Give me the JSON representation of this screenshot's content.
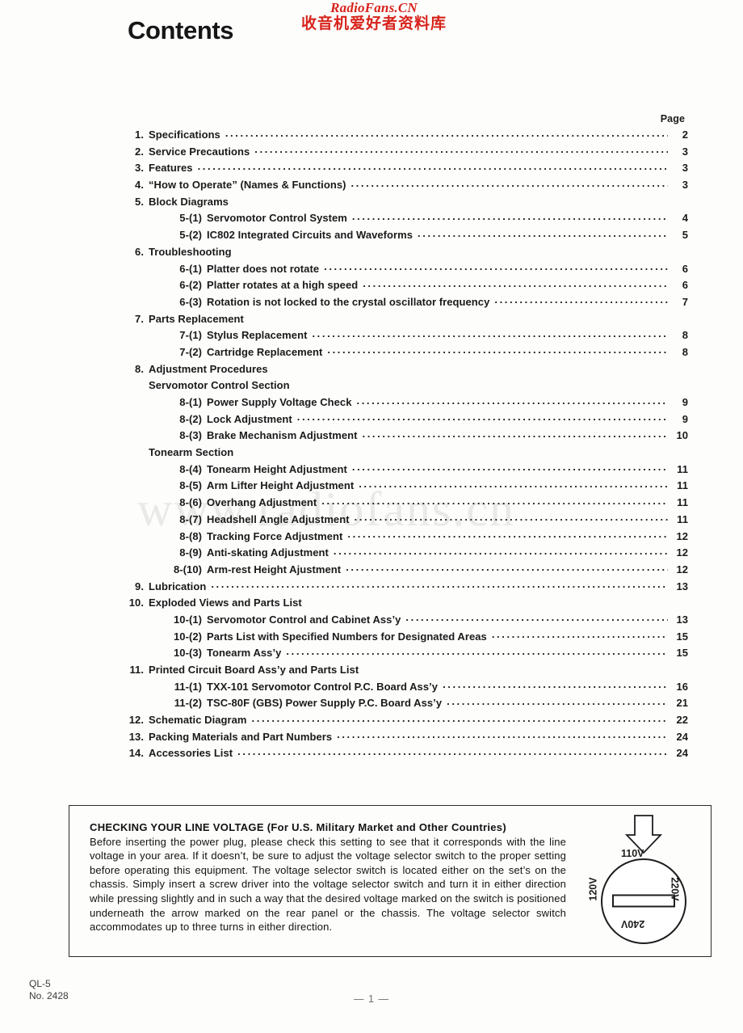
{
  "logo": {
    "english": "RadioFans.CN",
    "chinese": "收音机爱好者资料库",
    "color": "#d7231b"
  },
  "page_title": "Contents",
  "watermark": "www.radiofans.cn",
  "toc": {
    "page_column_header": "Page",
    "rows": [
      {
        "level": 1,
        "num": "1.",
        "label": "Specifications",
        "page": "2"
      },
      {
        "level": 1,
        "num": "2.",
        "label": "Service Precautions",
        "page": "3"
      },
      {
        "level": 1,
        "num": "3.",
        "label": "Features",
        "page": "3"
      },
      {
        "level": 1,
        "num": "4.",
        "label": "“How to Operate” (Names & Functions)",
        "page": "3"
      },
      {
        "level": 1,
        "num": "5.",
        "label": "Block Diagrams",
        "page": ""
      },
      {
        "level": 2,
        "num": "5-(1)",
        "label": "Servomotor Control System",
        "page": "4"
      },
      {
        "level": 2,
        "num": "5-(2)",
        "label": "IC802 Integrated Circuits and Waveforms",
        "page": "5"
      },
      {
        "level": 1,
        "num": "6.",
        "label": "Troubleshooting",
        "page": ""
      },
      {
        "level": 2,
        "num": "6-(1)",
        "label": "Platter does not rotate",
        "page": "6"
      },
      {
        "level": 2,
        "num": "6-(2)",
        "label": "Platter rotates at a high speed",
        "page": "6"
      },
      {
        "level": 2,
        "num": "6-(3)",
        "label": "Rotation is not locked to the crystal oscillator frequency",
        "page": "7"
      },
      {
        "level": 1,
        "num": "7.",
        "label": "Parts Replacement",
        "page": ""
      },
      {
        "level": 2,
        "num": "7-(1)",
        "label": "Stylus Replacement",
        "page": "8"
      },
      {
        "level": 2,
        "num": "7-(2)",
        "label": "Cartridge Replacement",
        "page": "8"
      },
      {
        "level": 1,
        "num": "8.",
        "label": "Adjustment Procedures",
        "page": ""
      },
      {
        "level": 0,
        "num": "",
        "label": "Servomotor Control Section",
        "page": ""
      },
      {
        "level": 2,
        "num": "8-(1)",
        "label": "Power Supply Voltage Check",
        "page": "9"
      },
      {
        "level": 2,
        "num": "8-(2)",
        "label": "Lock Adjustment",
        "page": "9"
      },
      {
        "level": 2,
        "num": "8-(3)",
        "label": "Brake Mechanism Adjustment",
        "page": "10"
      },
      {
        "level": 0,
        "num": "",
        "label": "Tonearm Section",
        "page": ""
      },
      {
        "level": 2,
        "num": "8-(4)",
        "label": "Tonearm Height Adjustment",
        "page": "11"
      },
      {
        "level": 2,
        "num": "8-(5)",
        "label": "Arm Lifter Height Adjustment",
        "page": "11"
      },
      {
        "level": 2,
        "num": "8-(6)",
        "label": "Overhang Adjustment",
        "page": "11"
      },
      {
        "level": 2,
        "num": "8-(7)",
        "label": "Headshell Angle Adjustment",
        "page": "11"
      },
      {
        "level": 2,
        "num": "8-(8)",
        "label": "Tracking Force Adjustment",
        "page": "12"
      },
      {
        "level": 2,
        "num": "8-(9)",
        "label": "Anti-skating Adjustment",
        "page": "12"
      },
      {
        "level": 2,
        "num": "8-(10)",
        "label": "Arm-rest Height Ajustment",
        "page": "12"
      },
      {
        "level": 1,
        "num": "9.",
        "label": "Lubrication",
        "page": "13"
      },
      {
        "level": 1,
        "num": "10.",
        "label": "Exploded Views and Parts List",
        "page": ""
      },
      {
        "level": 2,
        "num": "10-(1)",
        "label": "Servomotor Control and Cabinet Ass’y",
        "page": "13"
      },
      {
        "level": 2,
        "num": "10-(2)",
        "label": "Parts List with Specified Numbers for Designated Areas",
        "page": "15"
      },
      {
        "level": 2,
        "num": "10-(3)",
        "label": "Tonearm Ass’y",
        "page": "15"
      },
      {
        "level": 1,
        "num": "11.",
        "label": "Printed Circuit Board Ass’y and Parts List",
        "page": ""
      },
      {
        "level": 2,
        "num": "11-(1)",
        "label": "TXX-101  Servomotor Control P.C. Board Ass’y",
        "page": "16"
      },
      {
        "level": 2,
        "num": "11-(2)",
        "label": "TSC-80F (GBS) Power Supply P.C. Board Ass’y",
        "page": "21"
      },
      {
        "level": 1,
        "num": "12.",
        "label": "Schematic Diagram",
        "page": "22"
      },
      {
        "level": 1,
        "num": "13.",
        "label": "Packing Materials and Part Numbers",
        "page": "24"
      },
      {
        "level": 1,
        "num": "14.",
        "label": "Accessories List",
        "page": "24"
      }
    ]
  },
  "warning_box": {
    "heading": "CHECKING  YOUR  LINE VOLTAGE (For U.S. Military Market and Other Countries)",
    "body": "Before inserting the power plug, please check this setting to see that it corresponds with the line voltage in your area. If it doesn’t, be sure to adjust the voltage selector switch to the proper setting before operating this equipment. The voltage selector switch is located either on the set’s on the chassis. Simply insert a screw driver into the voltage selector switch and turn it in either direction while pressing slightly and in such a way that the desired voltage marked on the switch is positioned underneath the arrow marked on the rear panel or the chassis. The voltage selector switch accommodates up to three turns in either direction.",
    "voltage_selector": {
      "top": "110V",
      "left": "120V",
      "right": "220V",
      "bottom": "240V"
    }
  },
  "footer": {
    "model": "QL-5",
    "number": "No. 2428",
    "page_marker": "— 1 —"
  }
}
